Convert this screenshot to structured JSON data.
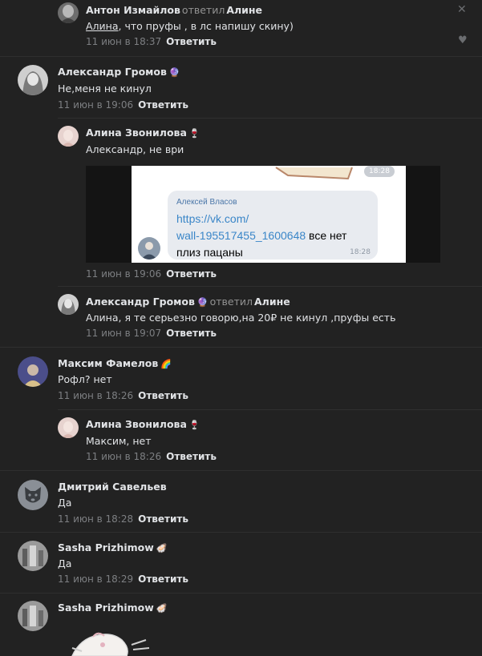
{
  "close_glyph": "✕",
  "like_glyph": "♥",
  "reply_label": "Ответить",
  "replied_word": "ответил",
  "comments": [
    {
      "author": "Антон Измайлов",
      "emoji": "",
      "replied_to": "Алине",
      "mention": "Алина",
      "text": ", что пруфы , в лс напишу скину)",
      "date": "11 июн в 18:37"
    },
    {
      "author": "Александр Громов",
      "emoji": "🔮",
      "replied_to": "",
      "mention": "",
      "text": "Не,меня не кинул",
      "date": "11 июн в 19:06"
    },
    {
      "author": "Алина Звонилова",
      "emoji": "🍷",
      "replied_to": "",
      "mention": "",
      "text": "Александр, не ври",
      "date": "11 июн в 19:06"
    },
    {
      "author": "Александр Громов",
      "emoji": "🔮",
      "replied_to": "Алине",
      "mention": "",
      "text": "Алина, я те серьезно говорю,на 20₽ не кинул ,пруфы есть",
      "date": "11 июн в 19:07"
    },
    {
      "author": "Максим Фамелов",
      "emoji": "🌈",
      "replied_to": "",
      "mention": "",
      "text": "Рофл? нет",
      "date": "11 июн в 18:26"
    },
    {
      "author": "Алина Звонилова",
      "emoji": "🍷",
      "replied_to": "",
      "mention": "",
      "text": "Максим, нет",
      "date": "11 июн в 18:26"
    },
    {
      "author": "Дмитрий Савельев",
      "emoji": "",
      "replied_to": "",
      "mention": "",
      "text": "Да",
      "date": "11 июн в 18:28"
    },
    {
      "author": "Sasha Prizhimow",
      "emoji": "🦪",
      "replied_to": "",
      "mention": "",
      "text": "Да",
      "date": "11 июн в 18:29"
    },
    {
      "author": "Sasha Prizhimow",
      "emoji": "🦪",
      "replied_to": "",
      "mention": "",
      "text": "",
      "date": ""
    }
  ],
  "attachment": {
    "top_time": "18:28",
    "bubble_name": "Алексей Власов",
    "link_line1": "https://vk.com/",
    "link_line2": "wall-195517455_1600648",
    "link_rest2": " все нет",
    "line3": "плиз пацаны",
    "bubble_time": "18:28"
  }
}
